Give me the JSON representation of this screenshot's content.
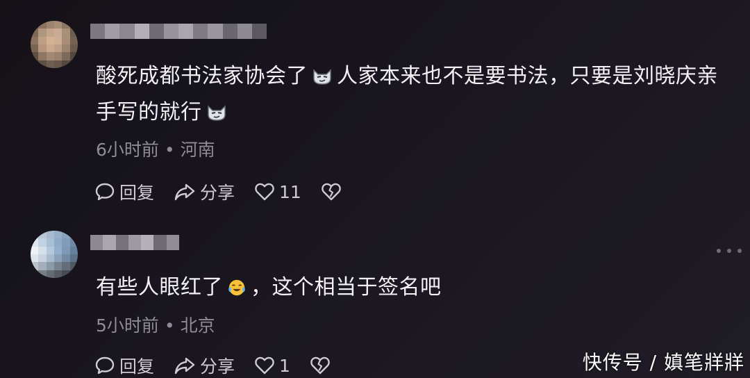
{
  "comments": [
    {
      "text_part1": "酸死成都书法家协会了",
      "text_part2": "人家本来也不是要书法，只要是刘晓庆亲手写的就行",
      "time": "6小时前",
      "location": "河南",
      "reply_label": "回复",
      "share_label": "分享",
      "like_count": "11"
    },
    {
      "text_part1": "有些人眼红了",
      "text_part2": "，这个相当于签名吧",
      "time": "5小时前",
      "location": "北京",
      "reply_label": "回复",
      "share_label": "分享",
      "like_count": "1"
    }
  ],
  "separator": "•",
  "icons": {
    "reply": "comment-bubble-icon",
    "share": "share-arrow-icon",
    "like": "heart-icon",
    "dislike": "broken-heart-icon",
    "more": "more-dots-icon",
    "emoji1": "smirk-cat-emoji",
    "emoji2": "crying-laughing-emoji"
  },
  "watermark": "快传号 / 嫃笔牂牂",
  "colors": {
    "text": "#f3f1f6",
    "meta": "#8f8b97",
    "actions": "#cfcbd5"
  }
}
